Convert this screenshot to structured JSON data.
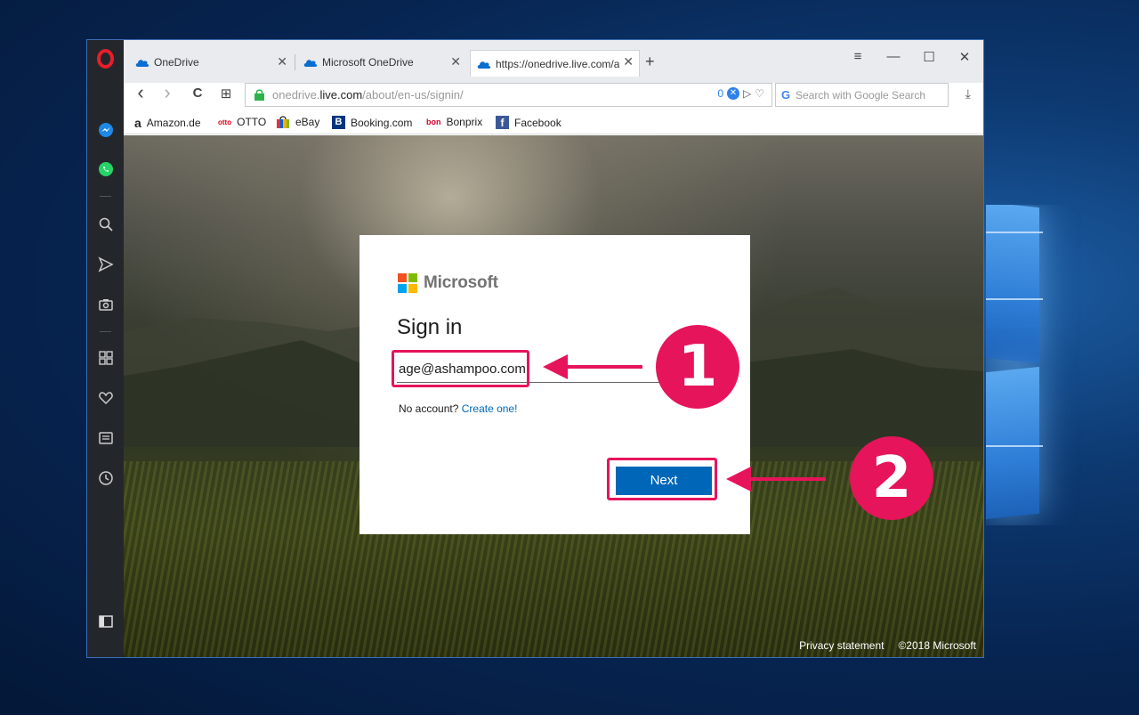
{
  "browser": {
    "tabs": [
      {
        "label": "OneDrive",
        "active": false
      },
      {
        "label": "Microsoft OneDrive",
        "active": false
      },
      {
        "label": "https://onedrive.live.com/a",
        "active": true
      }
    ],
    "new_tab": "+",
    "window_controls": {
      "menu": "≡",
      "minimize": "—",
      "maximize": "☐",
      "close": "✕"
    },
    "nav": {
      "back": "‹",
      "forward": "›",
      "reload": "C",
      "speed_dial": "⊞"
    },
    "address": {
      "host": "onedrive.live.com",
      "path": "/about/en-us/signin/",
      "pre": "onedrive.",
      "host_main": "live.com",
      "blocked_count": "0"
    },
    "search": {
      "placeholder": "Search with Google Search"
    },
    "bookmarks": [
      {
        "label": "Amazon.de",
        "icon": "a"
      },
      {
        "label": "OTTO",
        "icon": "otto"
      },
      {
        "label": "eBay",
        "icon": "bag"
      },
      {
        "label": "Booking.com",
        "icon": "B"
      },
      {
        "label": "Bonprix",
        "icon": "bon"
      },
      {
        "label": "Facebook",
        "icon": "f"
      }
    ]
  },
  "signin": {
    "brand": "Microsoft",
    "title": "Sign in",
    "email_value": "age@ashampoo.com",
    "no_account": "No account?",
    "create_link": "Create one!",
    "next_label": "Next"
  },
  "footer": {
    "privacy": "Privacy statement",
    "copyright": "©2018 Microsoft"
  },
  "annotations": {
    "step1": "1",
    "step2": "2",
    "color": "#e6145a"
  }
}
